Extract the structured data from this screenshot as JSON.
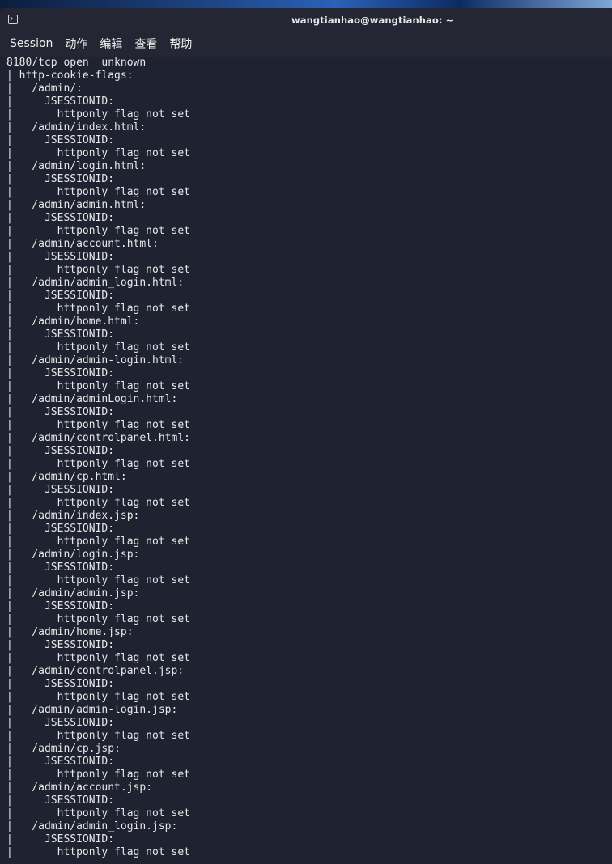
{
  "window": {
    "title": "wangtianhao@wangtianhao: ~",
    "icon": "terminal-icon"
  },
  "menu": [
    {
      "label": "Session"
    },
    {
      "label": "动作"
    },
    {
      "label": "编辑"
    },
    {
      "label": "查看"
    },
    {
      "label": "帮助"
    }
  ],
  "terminal": {
    "lines": [
      "8180/tcp open  unknown",
      "| http-cookie-flags:",
      "|   /admin/:",
      "|     JSESSIONID:",
      "|       httponly flag not set",
      "|   /admin/index.html:",
      "|     JSESSIONID:",
      "|       httponly flag not set",
      "|   /admin/login.html:",
      "|     JSESSIONID:",
      "|       httponly flag not set",
      "|   /admin/admin.html:",
      "|     JSESSIONID:",
      "|       httponly flag not set",
      "|   /admin/account.html:",
      "|     JSESSIONID:",
      "|       httponly flag not set",
      "|   /admin/admin_login.html:",
      "|     JSESSIONID:",
      "|       httponly flag not set",
      "|   /admin/home.html:",
      "|     JSESSIONID:",
      "|       httponly flag not set",
      "|   /admin/admin-login.html:",
      "|     JSESSIONID:",
      "|       httponly flag not set",
      "|   /admin/adminLogin.html:",
      "|     JSESSIONID:",
      "|       httponly flag not set",
      "|   /admin/controlpanel.html:",
      "|     JSESSIONID:",
      "|       httponly flag not set",
      "|   /admin/cp.html:",
      "|     JSESSIONID:",
      "|       httponly flag not set",
      "|   /admin/index.jsp:",
      "|     JSESSIONID:",
      "|       httponly flag not set",
      "|   /admin/login.jsp:",
      "|     JSESSIONID:",
      "|       httponly flag not set",
      "|   /admin/admin.jsp:",
      "|     JSESSIONID:",
      "|       httponly flag not set",
      "|   /admin/home.jsp:",
      "|     JSESSIONID:",
      "|       httponly flag not set",
      "|   /admin/controlpanel.jsp:",
      "|     JSESSIONID:",
      "|       httponly flag not set",
      "|   /admin/admin-login.jsp:",
      "|     JSESSIONID:",
      "|       httponly flag not set",
      "|   /admin/cp.jsp:",
      "|     JSESSIONID:",
      "|       httponly flag not set",
      "|   /admin/account.jsp:",
      "|     JSESSIONID:",
      "|       httponly flag not set",
      "|   /admin/admin_login.jsp:",
      "|     JSESSIONID:",
      "|       httponly flag not set"
    ]
  },
  "colors": {
    "terminal_background": "#1f2230",
    "window_background": "#242733",
    "text": "#e8e8e8"
  }
}
